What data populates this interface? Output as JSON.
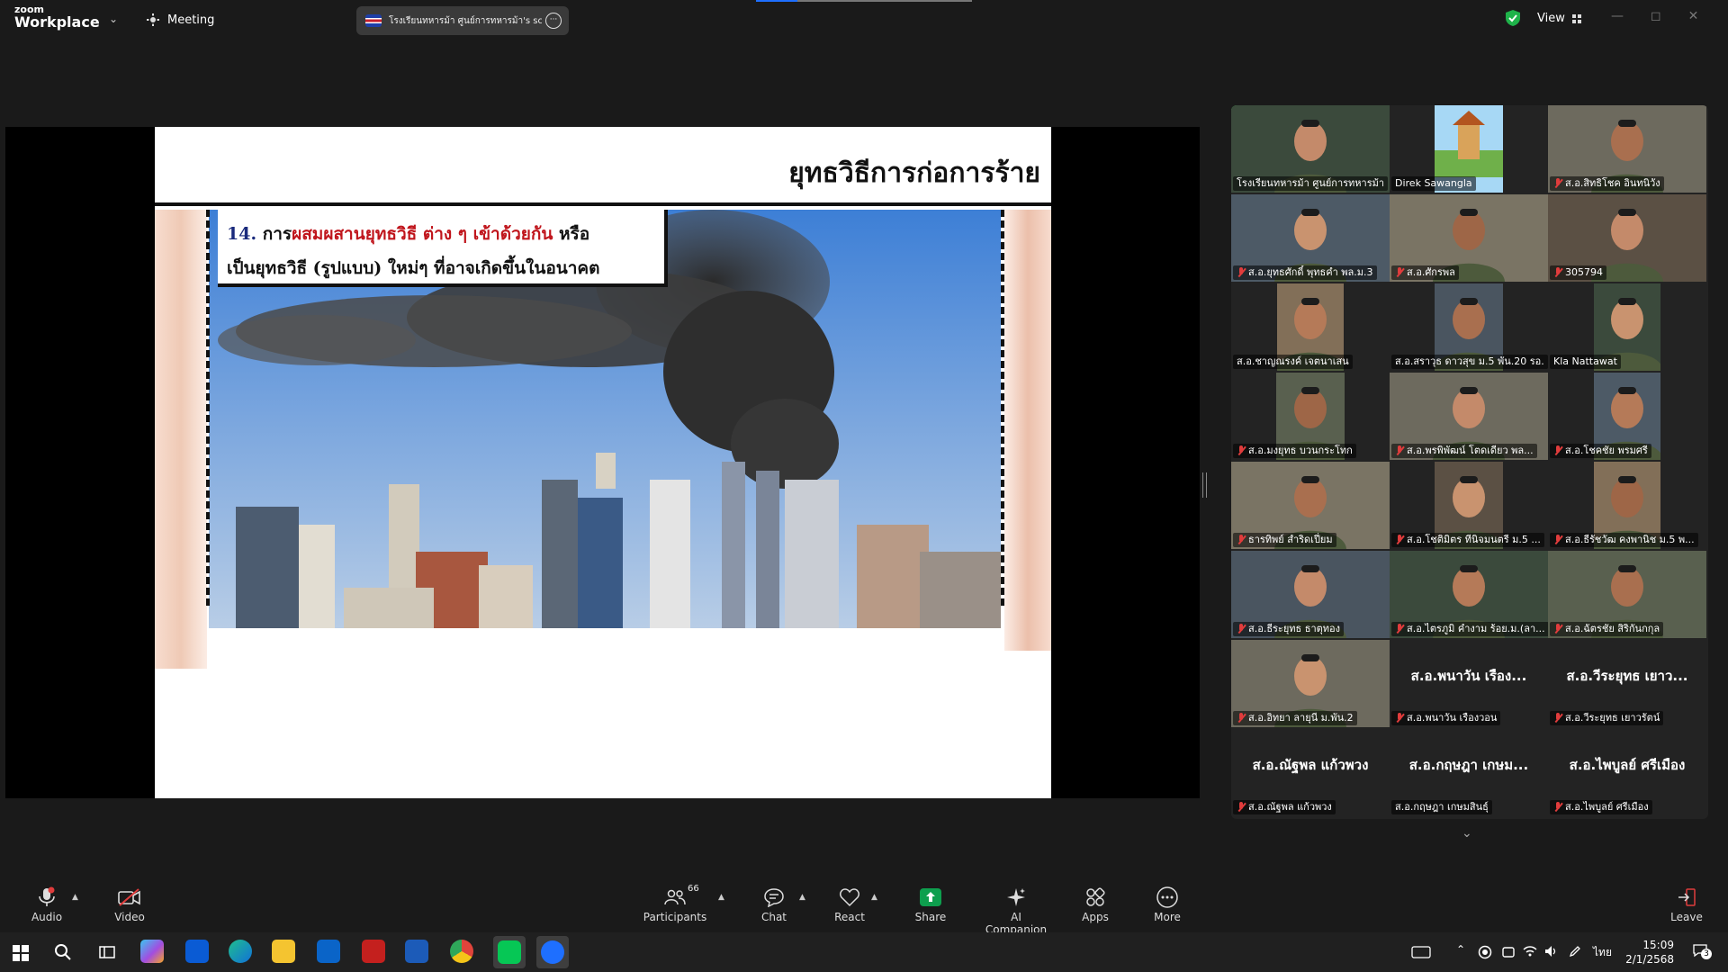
{
  "app": {
    "logo_line1": "zoom",
    "logo_line2": "Workplace",
    "meeting_label": "Meeting",
    "view_label": "View"
  },
  "share_pill": {
    "title": "โรงเรียนทหารม้า ศูนย์การทหารม้า's scr"
  },
  "slide": {
    "title": "ยุทธวิธีการก่อการร้าย",
    "item_number": "14.",
    "line1_prefix": "การ",
    "line1_red": "ผสมผสานยุทธวิธี ต่าง ๆ เข้าด้วยกัน",
    "line1_suffix": " หรือ",
    "line2": "เป็นยุทธวิธี (รูปแบบ) ใหม่ๆ ที่อาจเกิดขึ้นในอนาคต"
  },
  "participants": [
    {
      "name": "โรงเรียนทหารม้า ศูนย์การทหารม้า",
      "muted": false,
      "video": true,
      "active": true
    },
    {
      "name": "Direk Sawangla",
      "muted": false,
      "video": true
    },
    {
      "name": "ส.อ.สิทธิโชค อินทนิวัง",
      "muted": true,
      "video": true
    },
    {
      "name": "ส.อ.ยุทธศักดิ์ พุทธคำ พล.ม.3",
      "muted": true,
      "video": true
    },
    {
      "name": "ส.อ.ศักรพล",
      "muted": true,
      "video": true
    },
    {
      "name": "305794",
      "muted": true,
      "video": true
    },
    {
      "name": "ส.อ.ชาญณรงค์ เจตนาเสน",
      "muted": false,
      "video": true
    },
    {
      "name": "ส.อ.สราวุธ ดาวสุข ม.5 พัน.20 รอ.",
      "muted": false,
      "video": true
    },
    {
      "name": "Kla Nattawat",
      "muted": false,
      "video": true
    },
    {
      "name": "ส.อ.มงยุทธ บวนกระโทก",
      "muted": true,
      "video": true
    },
    {
      "name": "ส.อ.พรพิพัฒน์ โตดเดียว พล...",
      "muted": true,
      "video": true
    },
    {
      "name": "ส.อ.โชคชัย พรมศรี",
      "muted": true,
      "video": true
    },
    {
      "name": "ธารทิพย์ สำริดเปี่ยม",
      "muted": true,
      "video": true
    },
    {
      "name": "ส.อ.โชติมิตร ทีนิจมนตรี ม.5 ...",
      "muted": true,
      "video": true
    },
    {
      "name": "ส.อ.ธีรัชวัฒ คงพานิช ม.5 พ...",
      "muted": true,
      "video": true
    },
    {
      "name": "ส.อ.ธีระยุทธ ธาตุทอง",
      "muted": true,
      "video": true
    },
    {
      "name": "ส.อ.ไตรภูมิ คำงาม ร้อย.ม.(ลา...",
      "muted": true,
      "video": true
    },
    {
      "name": "ส.อ.ฉัตรชัย สิริกันกกุล",
      "muted": true,
      "video": true
    },
    {
      "name": "ส.อ.อิทยา ลายุนี ม.พัน.2",
      "muted": true,
      "video": true
    },
    {
      "name": "ส.อ.พนาวัน เรืองวอน",
      "big": "ส.อ.พนาวัน เรือง...",
      "muted": true,
      "video": false
    },
    {
      "name": "ส.อ.วีระยุทธ เยาวรัตน์",
      "big": "ส.อ.วีระยุทธ เยาว...",
      "muted": true,
      "video": false
    },
    {
      "name": "ส.อ.ณัฐพล แก้วพวง",
      "big": "ส.อ.ณัฐพล แก้วพวง",
      "muted": true,
      "video": false
    },
    {
      "name": "ส.อ.กฤษฎา เกษมสินธุ์",
      "big": "ส.อ.กฤษฎา เกษม...",
      "muted": false,
      "video": false
    },
    {
      "name": "ส.อ.ไพบูลย์ ศรีเมือง",
      "big": "ส.อ.ไพบูลย์ ศรีเมือง",
      "muted": true,
      "video": false
    }
  ],
  "toolbar": {
    "audio": "Audio",
    "video": "Video",
    "participants": "Participants",
    "participants_count": "66",
    "chat": "Chat",
    "react": "React",
    "share": "Share",
    "ai_companion": "AI Companion",
    "apps": "Apps",
    "more": "More",
    "leave": "Leave"
  },
  "taskbar": {
    "time": "15:09",
    "date": "2/1/2568",
    "lang": "ไทย",
    "notif": "3"
  },
  "colors": {
    "active_border": "#3fd15a",
    "share_green": "#0e9f4e",
    "mute_red": "#e03c3c",
    "slide_red": "#c0151c",
    "slide_blue": "#1a2a7c"
  },
  "icons": [
    "shield-check-icon",
    "grid-icon",
    "mic-icon",
    "video-off-icon",
    "people-icon",
    "chat-icon",
    "heart-icon",
    "share-up-icon",
    "sparkle-icon",
    "apps-icon",
    "ellipsis-icon",
    "leave-icon",
    "pen-icon"
  ]
}
